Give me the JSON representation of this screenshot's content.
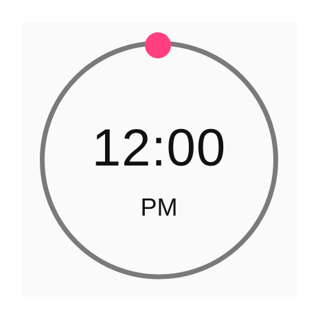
{
  "clock": {
    "time": "12:00",
    "period": "PM",
    "handle_position": "12 o'clock"
  },
  "colors": {
    "ring": "#7a7a7a",
    "handle": "#ff3f7f",
    "panel": "#fafafa",
    "text": "#111111"
  },
  "icons": {
    "handle": "drag-handle-dot"
  }
}
